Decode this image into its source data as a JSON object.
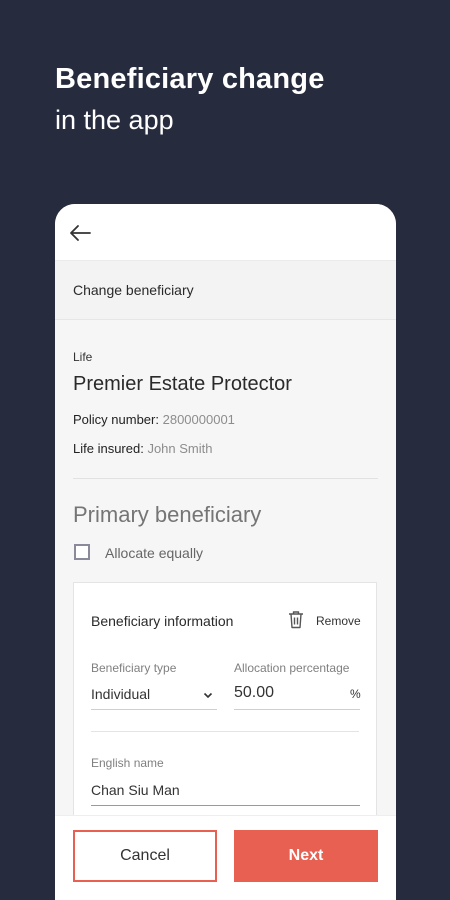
{
  "hero": {
    "title": "Beneficiary change",
    "subtitle": "in the app"
  },
  "screen": {
    "section_title": "Change beneficiary",
    "policy": {
      "type": "Life",
      "name": "Premier Estate Protector",
      "policy_number_label": "Policy number:",
      "policy_number_value": "2800000001",
      "life_insured_label": "Life insured:",
      "life_insured_value": "John Smith"
    },
    "primary_title": "Primary beneficiary",
    "allocate_equally": {
      "label": "Allocate equally",
      "checked": false
    },
    "beneficiary_card": {
      "title": "Beneficiary information",
      "remove_label": "Remove",
      "type_label": "Beneficiary type",
      "type_value": "Individual",
      "allocation_label": "Allocation percentage",
      "allocation_value": "50.00",
      "allocation_unit": "%",
      "english_name_label": "English name",
      "english_name_value": "Chan Siu Man"
    },
    "buttons": {
      "cancel": "Cancel",
      "next": "Next"
    }
  },
  "colors": {
    "background": "#262b3d",
    "accent": "#e76052"
  },
  "icons": {
    "back": "arrow-left-icon",
    "remove": "trash-icon",
    "dropdown": "chevron-down-icon"
  }
}
